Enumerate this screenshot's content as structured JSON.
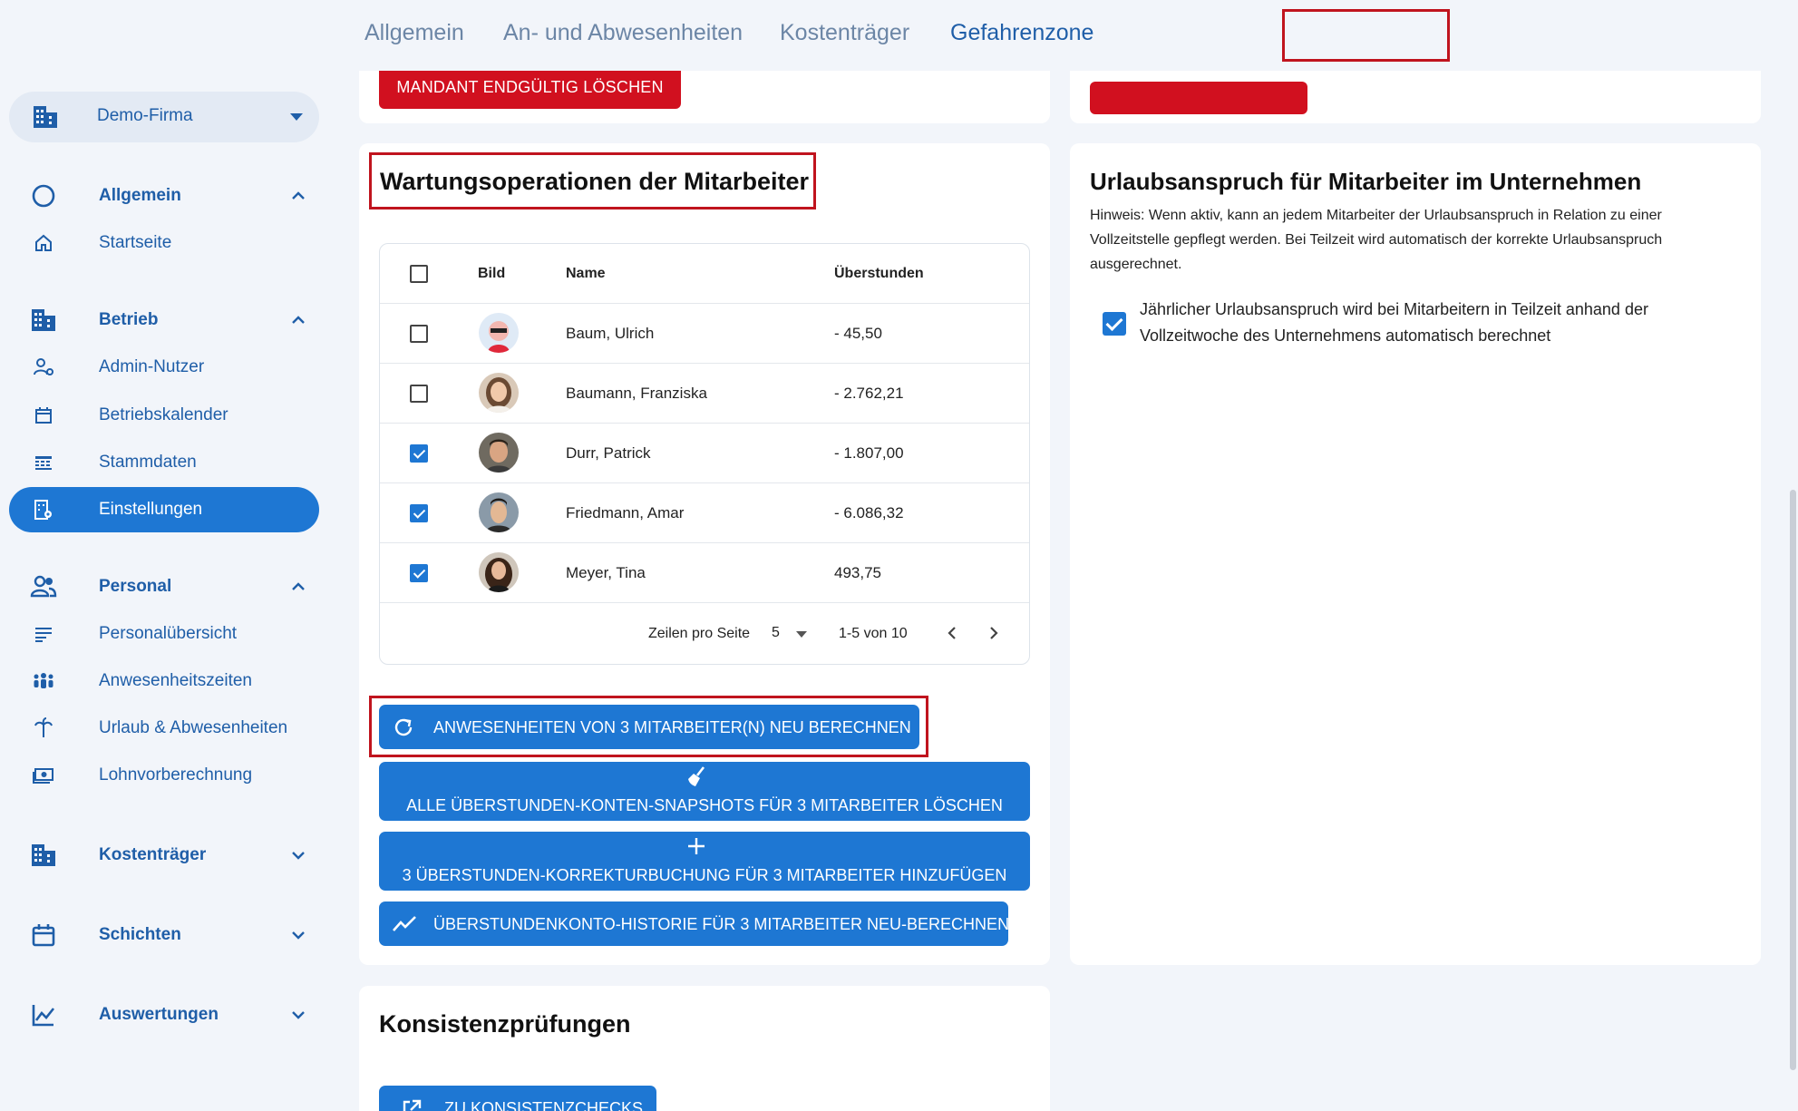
{
  "sidebar": {
    "company": {
      "label": "Demo-Firma",
      "icon": "building-icon"
    },
    "items": [
      {
        "label": "Allgemein",
        "icon": "circle-icon",
        "group": true,
        "expanded": true
      },
      {
        "label": "Startseite",
        "icon": "home-icon"
      },
      {
        "label": "Betrieb",
        "icon": "building-icon",
        "group": true,
        "expanded": true
      },
      {
        "label": "Admin-Nutzer",
        "icon": "admin-user-icon"
      },
      {
        "label": "Betriebskalender",
        "icon": "calendar-icon"
      },
      {
        "label": "Stammdaten",
        "icon": "master-data-icon"
      },
      {
        "label": "Einstellungen",
        "icon": "settings-building-icon",
        "active": true
      },
      {
        "label": "Personal",
        "icon": "people-icon",
        "group": true,
        "expanded": true
      },
      {
        "label": "Personalübersicht",
        "icon": "list-icon"
      },
      {
        "label": "Anwesenheitszeiten",
        "icon": "group-icon"
      },
      {
        "label": "Urlaub & Abwesenheiten",
        "icon": "palm-tree-icon"
      },
      {
        "label": "Lohnvorberechnung",
        "icon": "money-icon"
      },
      {
        "label": "Kostenträger",
        "icon": "building-icon",
        "group": true,
        "expanded": false
      },
      {
        "label": "Schichten",
        "icon": "calendar-icon",
        "group": true,
        "expanded": false
      },
      {
        "label": "Auswertungen",
        "icon": "chart-line-icon",
        "group": true,
        "expanded": false
      }
    ]
  },
  "tabs": [
    {
      "label": "Allgemein"
    },
    {
      "label": "An- und Abwesenheiten"
    },
    {
      "label": "Kostenträger"
    },
    {
      "label": "Gefahrenzone",
      "active": true
    }
  ],
  "danger": {
    "delete_label": "MANDANT ENDGÜLTIG LÖSCHEN"
  },
  "maintenance": {
    "title": "Wartungsoperationen der Mitarbeiter",
    "columns": [
      "Bild",
      "Name",
      "Überstunden"
    ],
    "rows": [
      {
        "name": "Baum, Ulrich",
        "overtime": "- 45,50",
        "checked": false
      },
      {
        "name": "Baumann, Franziska",
        "overtime": "- 2.762,21",
        "checked": false
      },
      {
        "name": "Durr, Patrick",
        "overtime": "- 1.807,00",
        "checked": true
      },
      {
        "name": "Friedmann, Amar",
        "overtime": "- 6.086,32",
        "checked": true
      },
      {
        "name": "Meyer, Tina",
        "overtime": "493,75",
        "checked": true
      }
    ],
    "pagination": {
      "rows_per_page_label": "Zeilen pro Seite",
      "rows_per_page": "5",
      "range": "1-5 von 10"
    },
    "actions": {
      "recalc": "ANWESENHEITEN VON 3 MITARBEITER(N) NEU BERECHNEN",
      "delete_snapshots": "ALLE ÜBERSTUNDEN-KONTEN-SNAPSHOTS FÜR 3 MITARBEITER LÖSCHEN",
      "add_correction": "3 ÜBERSTUNDEN-KORREKTURBUCHUNG FÜR 3 MITARBEITER HINZUFÜGEN",
      "recalc_history": "ÜBERSTUNDENKONTO-HISTORIE FÜR 3 MITARBEITER NEU-BERECHNEN"
    }
  },
  "vacation": {
    "title": "Urlaubsanspruch für Mitarbeiter im Unternehmen",
    "hint": "Hinweis: Wenn aktiv, kann an jedem Mitarbeiter der Urlaubsanspruch in Relation zu einer Vollzeitstelle gepflegt werden. Bei Teilzeit wird automatisch der korrekte Urlaubsanspruch ausgerechnet.",
    "checkbox_label": "Jährlicher Urlaubsanspruch wird bei Mitarbeitern in Teilzeit anhand der Vollzeitwoche des Unternehmens automatisch berechnet",
    "checked": true
  },
  "consistency": {
    "title": "Konsistenzprüfungen",
    "button_label": "ZU KONSISTENZCHECKS"
  },
  "colors": {
    "primary": "#1e77d3",
    "danger": "#d1101f",
    "highlight": "#c0141e",
    "nav_text": "#1f5ea8"
  }
}
